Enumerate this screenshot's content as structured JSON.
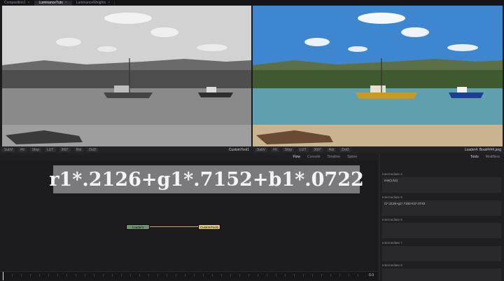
{
  "tabs": [
    {
      "label": "Composition1",
      "active": false
    },
    {
      "label": "LuminanceTuto",
      "active": true
    },
    {
      "label": "LuminanceWeights",
      "active": false
    }
  ],
  "viewer_left": {
    "tool1": "SubV",
    "tool2": "Fit",
    "tool3": "Stop",
    "tool4": "LUT",
    "tool5": "360°",
    "tool6": "Roi",
    "tool7": "DoD",
    "node_name": "CustomTool1"
  },
  "viewer_right": {
    "tool1": "SubV",
    "tool2": "Fit",
    "tool3": "Stop",
    "tool4": "LUT",
    "tool5": "360°",
    "tool6": "Roi",
    "tool7": "DoD",
    "node_name": "Loader4: Boat####.png"
  },
  "flow_tabs": [
    "Flow",
    "Console",
    "Timeline",
    "Spline"
  ],
  "formula": "r1*.2126+g1*.7152+b1*.0722",
  "nodes": [
    {
      "label": "Loader4",
      "color": "#6e8f6e"
    },
    {
      "label": "CustomTool1",
      "color": "#d9c673"
    }
  ],
  "timeline": {
    "value": "0.0"
  },
  "inspector": {
    "tabs": [
      "Tools",
      "Modifiers"
    ],
    "fields": [
      {
        "label": "Intermediate 4",
        "value": "min(1,b1)"
      },
      {
        "label": "Intermediate 5",
        "value": "r1*.2126+g1*.7152+b1*.0722"
      },
      {
        "label": "Intermediate 6",
        "value": ""
      },
      {
        "label": "Intermediate 7",
        "value": ""
      },
      {
        "label": "Intermediate 8",
        "value": ""
      }
    ]
  }
}
